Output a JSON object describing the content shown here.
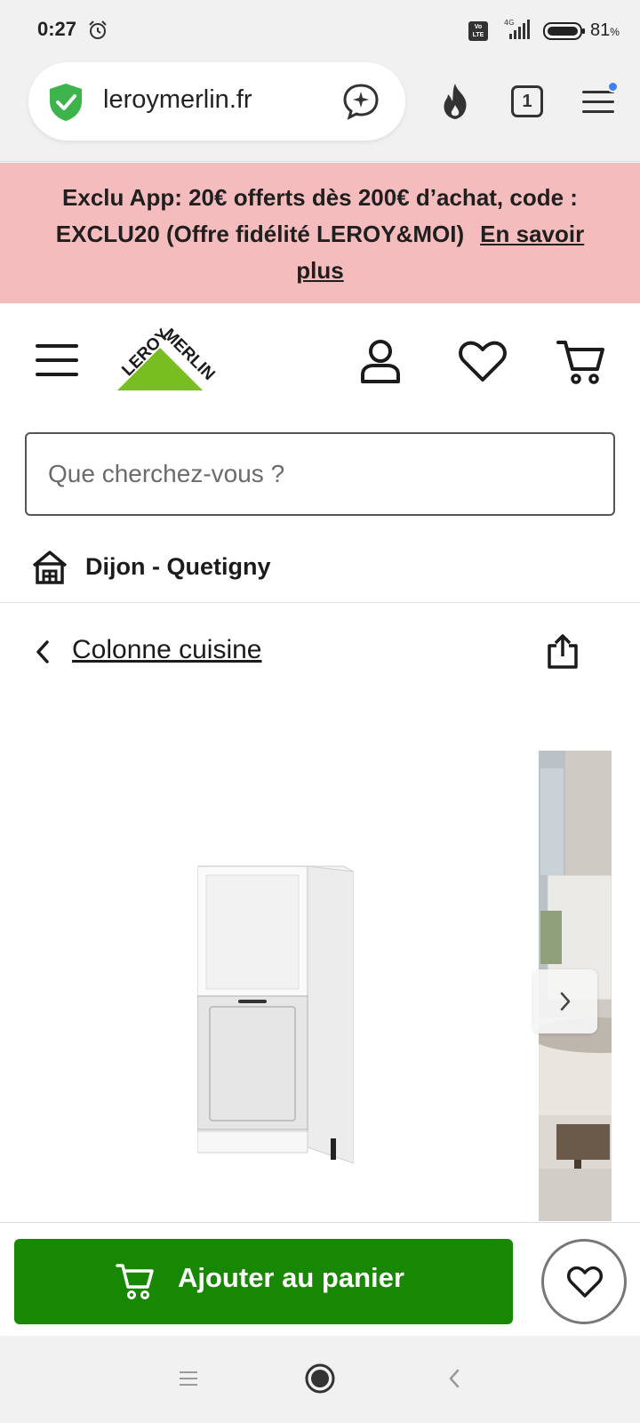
{
  "status_bar": {
    "time": "0:27",
    "network": "4G",
    "volte": "Vo LTE",
    "battery": "81",
    "battery_unit": "%"
  },
  "browser": {
    "url": "leroymerlin.fr",
    "tab_count": "1",
    "secure_color": "#3cb44b"
  },
  "promo": {
    "text": "Exclu App: 20€ offerts dès 200€ d’achat, code : EXCLU20 (Offre fidélité LEROY&MOI)",
    "link": "En savoir plus",
    "background": "#f5bcbe"
  },
  "header": {
    "logo_text_left": "LEROY",
    "logo_text_right": "MERLIN",
    "brand_color": "#78be20"
  },
  "search": {
    "placeholder": "Que cherchez-vous ?",
    "value": ""
  },
  "store": {
    "name": "Dijon - Quetigny"
  },
  "breadcrumb": {
    "label": "Colonne cuisine"
  },
  "actions": {
    "add_to_cart_label": "Ajouter au panier",
    "button_color": "#188803"
  }
}
